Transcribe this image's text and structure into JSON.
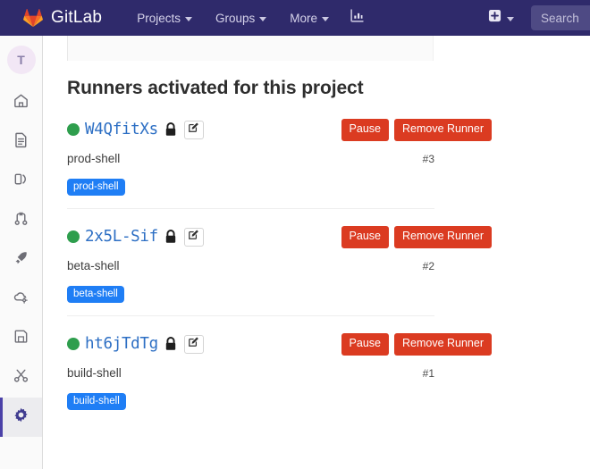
{
  "topbar": {
    "brand": "GitLab",
    "brand_logo_icon": "gitlab-tanuki-logo",
    "nav": [
      {
        "label": "Projects",
        "icon": "chevron-down-icon"
      },
      {
        "label": "Groups",
        "icon": "chevron-down-icon"
      },
      {
        "label": "More",
        "icon": "chevron-down-icon"
      }
    ],
    "analytics_icon": "chart-analytics-icon",
    "create_new_icon": "plus-square-icon",
    "create_new_caret_icon": "chevron-down-icon",
    "search_placeholder": "Search"
  },
  "sidebar": {
    "avatar_initial": "T",
    "items": [
      {
        "name": "home",
        "icon": "home-icon",
        "active": false
      },
      {
        "name": "issues",
        "icon": "document-icon",
        "active": false
      },
      {
        "name": "repository",
        "icon": "book-icon",
        "active": false
      },
      {
        "name": "merge-requests",
        "icon": "merge-request-icon",
        "active": false
      },
      {
        "name": "ci-cd",
        "icon": "rocket-icon",
        "active": false
      },
      {
        "name": "operations",
        "icon": "cloud-gear-icon",
        "active": false
      },
      {
        "name": "packages",
        "icon": "save-disk-icon",
        "active": false
      },
      {
        "name": "snippets",
        "icon": "scissors-icon",
        "active": false
      },
      {
        "name": "settings",
        "icon": "gear-icon",
        "active": true
      }
    ]
  },
  "main": {
    "page_title": "Runners activated for this project",
    "buttons": {
      "pause": "Pause",
      "remove": "Remove Runner"
    },
    "icons": {
      "status": "green-status-dot",
      "lock": "lock-icon",
      "edit": "pencil-edit-icon"
    },
    "runners": [
      {
        "token": "W4QfitXs",
        "description": "prod-shell",
        "id": "#3",
        "tag": "prod-shell",
        "status": "online"
      },
      {
        "token": "2x5L-Sif",
        "description": "beta-shell",
        "id": "#2",
        "tag": "beta-shell",
        "status": "online"
      },
      {
        "token": "ht6jTdTg",
        "description": "build-shell",
        "id": "#1",
        "tag": "build-shell",
        "status": "online"
      }
    ]
  },
  "colors": {
    "topbar_bg": "#2f2a6b",
    "danger": "#db3b21",
    "token_link": "#2d6fc4",
    "status_online": "#2e9e4d",
    "tag_bg": "#1f7ef5",
    "sidebar_active": "#4b41a8"
  }
}
